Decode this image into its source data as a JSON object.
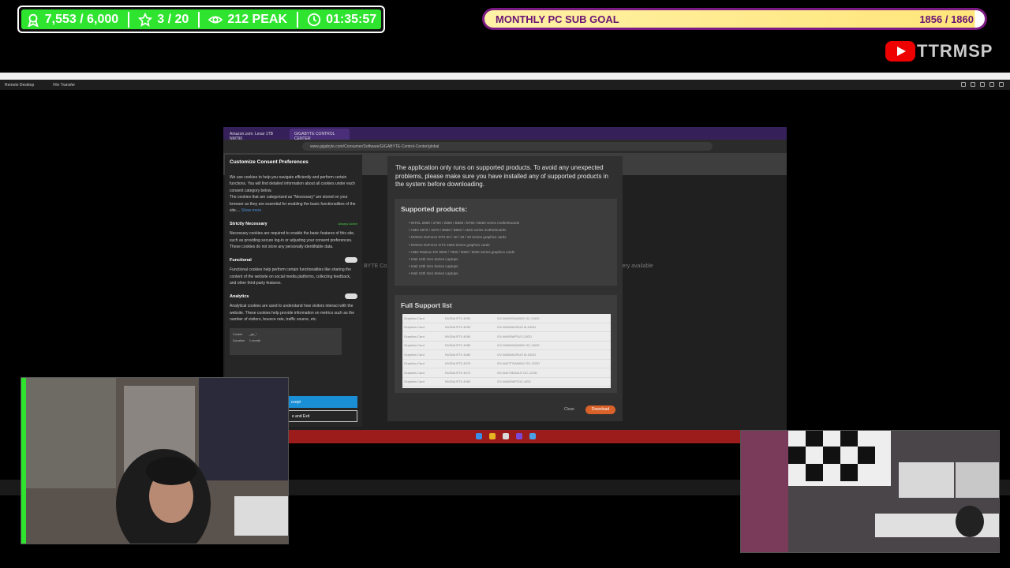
{
  "overlay": {
    "stats": {
      "followers": "7,553 / 6,000",
      "rating": "3 / 20",
      "peak": "212 PEAK",
      "timer": "01:35:57"
    },
    "goal": {
      "label": "MONTHLY PC SUB GOAL",
      "progress": "1856 / 1860",
      "fraction": 0.998
    },
    "brand": {
      "text": "TTRMSP"
    }
  },
  "remote_desktop": {
    "toolbar_items": [
      "Remote Desktop",
      "File Transfer"
    ]
  },
  "browser": {
    "tabs": [
      {
        "label": "Amazon.com: Lexar 1TB NM790"
      },
      {
        "label": "GIGABYTE CONTROL CENTER"
      }
    ],
    "url": "www.gigabyte.com/Consumer/Software/GIGABYTE-Control-Center/global",
    "bg_text_left": "BYTE Co",
    "bg_text_right": "very available"
  },
  "cookie_panel": {
    "title": "Customize Consent Preferences",
    "intro": "We use cookies to help you navigate efficiently and perform certain functions. You will find detailed information about all cookies under each consent category below.",
    "intro2": "The cookies that are categorized as \"Necessary\" are stored on your browser as they are essential for enabling the basic functionalities of the site....",
    "show_more": "Show more",
    "sections": [
      {
        "title": "Strictly Necessary",
        "status": "Always Active",
        "text": "Necessary cookies are required to enable the basic features of this site, such as providing secure log-in or adjusting your consent preferences. These cookies do not store any personally identifiable data."
      },
      {
        "title": "Functional",
        "text": "Functional cookies help perform certain functionalities like sharing the content of the website on social media platforms, collecting feedback, and other third-party features."
      },
      {
        "title": "Analytics",
        "text": "Analytical cookies are used to understand how visitors interact with the website. These cookies help provide information on metrics such as the number of visitors, bounce rate, traffic source, etc."
      }
    ],
    "table_rows": [
      {
        "key": "Cookie",
        "value": "_ga_*"
      },
      {
        "key": "Duration",
        "value": "1 month"
      }
    ],
    "accept_label": "ccept",
    "save_label": "e and Exit"
  },
  "modal": {
    "message": "The application only runs on supported products. To avoid any unexpected problems, please make sure you have installed any of supported products in the system before downloading.",
    "supported_title": "Supported products:",
    "supported_items": [
      "INTEL Z890 / Z790 / Z690 / B860 / B760 / B660 series motherboards",
      "AMD X870 / X670 / B850 / B650 / A620 series motherboards",
      "NVIDIA GeForce RTX 50 / 40 / 30 / 20 Series graphics cards",
      "NVIDIA GeForce GTX 1660 Series graphics cards",
      "AMD Radeon RX 9000 / 7000 / 6000 / 5000 Series graphics cards",
      "Intel 14th Gen Series Laptops",
      "Intel 13th Gen Series Laptops",
      "Intel 12th Gen Series Laptops"
    ],
    "full_support_title": "Full Support list",
    "full_support_rows": [
      [
        "Graphics Card",
        "NVIDIA RTX 4090",
        "GV-N4090GAMING OC-24GD"
      ],
      [
        "Graphics Card",
        "NVIDIA RTX 4090",
        "GV-N4090AORUS M-24GD"
      ],
      [
        "Graphics Card",
        "NVIDIA RTX 4090",
        "GV-N4090WF3V2-24GD"
      ],
      [
        "Graphics Card",
        "NVIDIA RTX 4080",
        "GV-N4080GAMING OC-16GD"
      ],
      [
        "Graphics Card",
        "NVIDIA RTX 4080",
        "GV-N4080AORUS M-16GD"
      ],
      [
        "Graphics Card",
        "NVIDIA RTX 4070",
        "GV-N407TGAMING OC-12GD"
      ],
      [
        "Graphics Card",
        "NVIDIA RTX 4070",
        "GV-N4070EAGLE OC-12GD"
      ],
      [
        "Graphics Card",
        "NVIDIA RTX 4060",
        "GV-N4060WF2OC-8GD"
      ],
      [
        "Graphics Card",
        "NVIDIA RTX 4060",
        "GV-N4060EAGLE OC-8GD"
      ]
    ],
    "close_label": "Close",
    "download_label": "Download"
  },
  "colors": {
    "stats_bg": "#2fe42f",
    "goal_border": "#7a1a82",
    "goal_fill": "#ffe67a",
    "download_button": "#d9622a",
    "accept_button": "#1a8fd6",
    "taskbar": "#9c1c1c"
  }
}
